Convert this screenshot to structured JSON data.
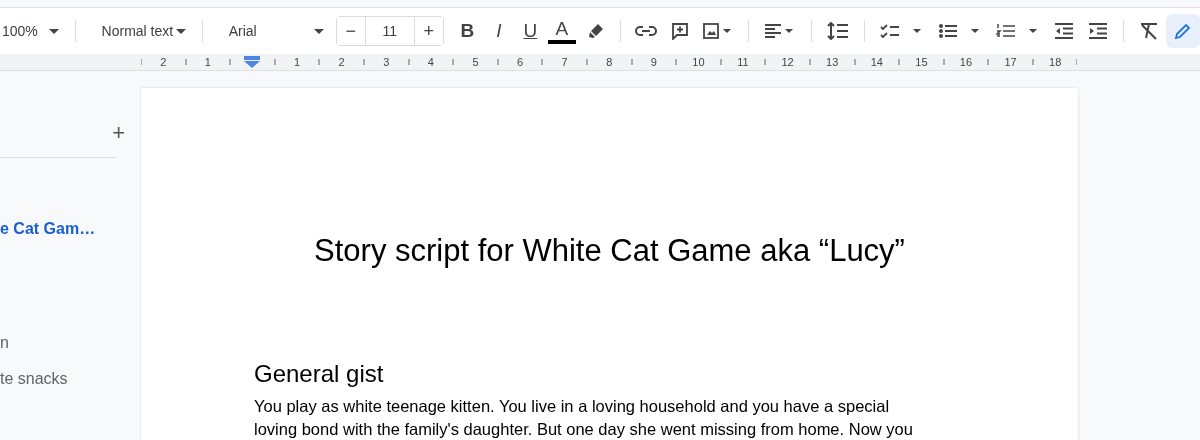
{
  "toolbar": {
    "zoom": "100%",
    "paragraph_style": "Normal text",
    "font": "Arial",
    "font_size": {
      "decrease": "−",
      "value": "11",
      "increase": "+"
    },
    "format_buttons": [
      {
        "kind": "bold",
        "label": "B"
      },
      {
        "kind": "italic",
        "label": "I"
      },
      {
        "kind": "underline",
        "label": "U"
      },
      {
        "kind": "text_color",
        "label": "A"
      }
    ]
  },
  "ruler": {
    "marks": [
      {
        "kind": "number",
        "text": "2"
      },
      {
        "kind": "number",
        "text": "1"
      },
      {
        "kind": "indent"
      },
      {
        "kind": "number",
        "text": "1"
      },
      {
        "kind": "number",
        "text": "2"
      },
      {
        "kind": "number",
        "text": "3"
      },
      {
        "kind": "number",
        "text": "4"
      },
      {
        "kind": "number",
        "text": "5"
      },
      {
        "kind": "number",
        "text": "6"
      },
      {
        "kind": "number",
        "text": "7"
      },
      {
        "kind": "number",
        "text": "8"
      },
      {
        "kind": "number",
        "text": "9"
      },
      {
        "kind": "number",
        "text": "10"
      },
      {
        "kind": "number",
        "text": "11"
      },
      {
        "kind": "number",
        "text": "12"
      },
      {
        "kind": "number",
        "text": "13"
      },
      {
        "kind": "number",
        "text": "14"
      },
      {
        "kind": "number",
        "text": "15"
      },
      {
        "kind": "number",
        "text": "16"
      },
      {
        "kind": "number",
        "text": "17"
      },
      {
        "kind": "number",
        "text": "18"
      }
    ]
  },
  "outline": {
    "add": "+",
    "items": [
      {
        "text": "e Cat Gam…",
        "selected": true
      },
      {
        "text": "n",
        "selected": false
      },
      {
        "text": "te snacks",
        "selected": false
      }
    ]
  },
  "document": {
    "title": "Story script for White Cat Game aka “Lucy”",
    "heading": "General gist",
    "paragraph": [
      "You play as white teenage kitten. You live in a loving household and you have a special",
      "loving bond with the family's daughter. But one day she went missing from home. Now you"
    ]
  }
}
